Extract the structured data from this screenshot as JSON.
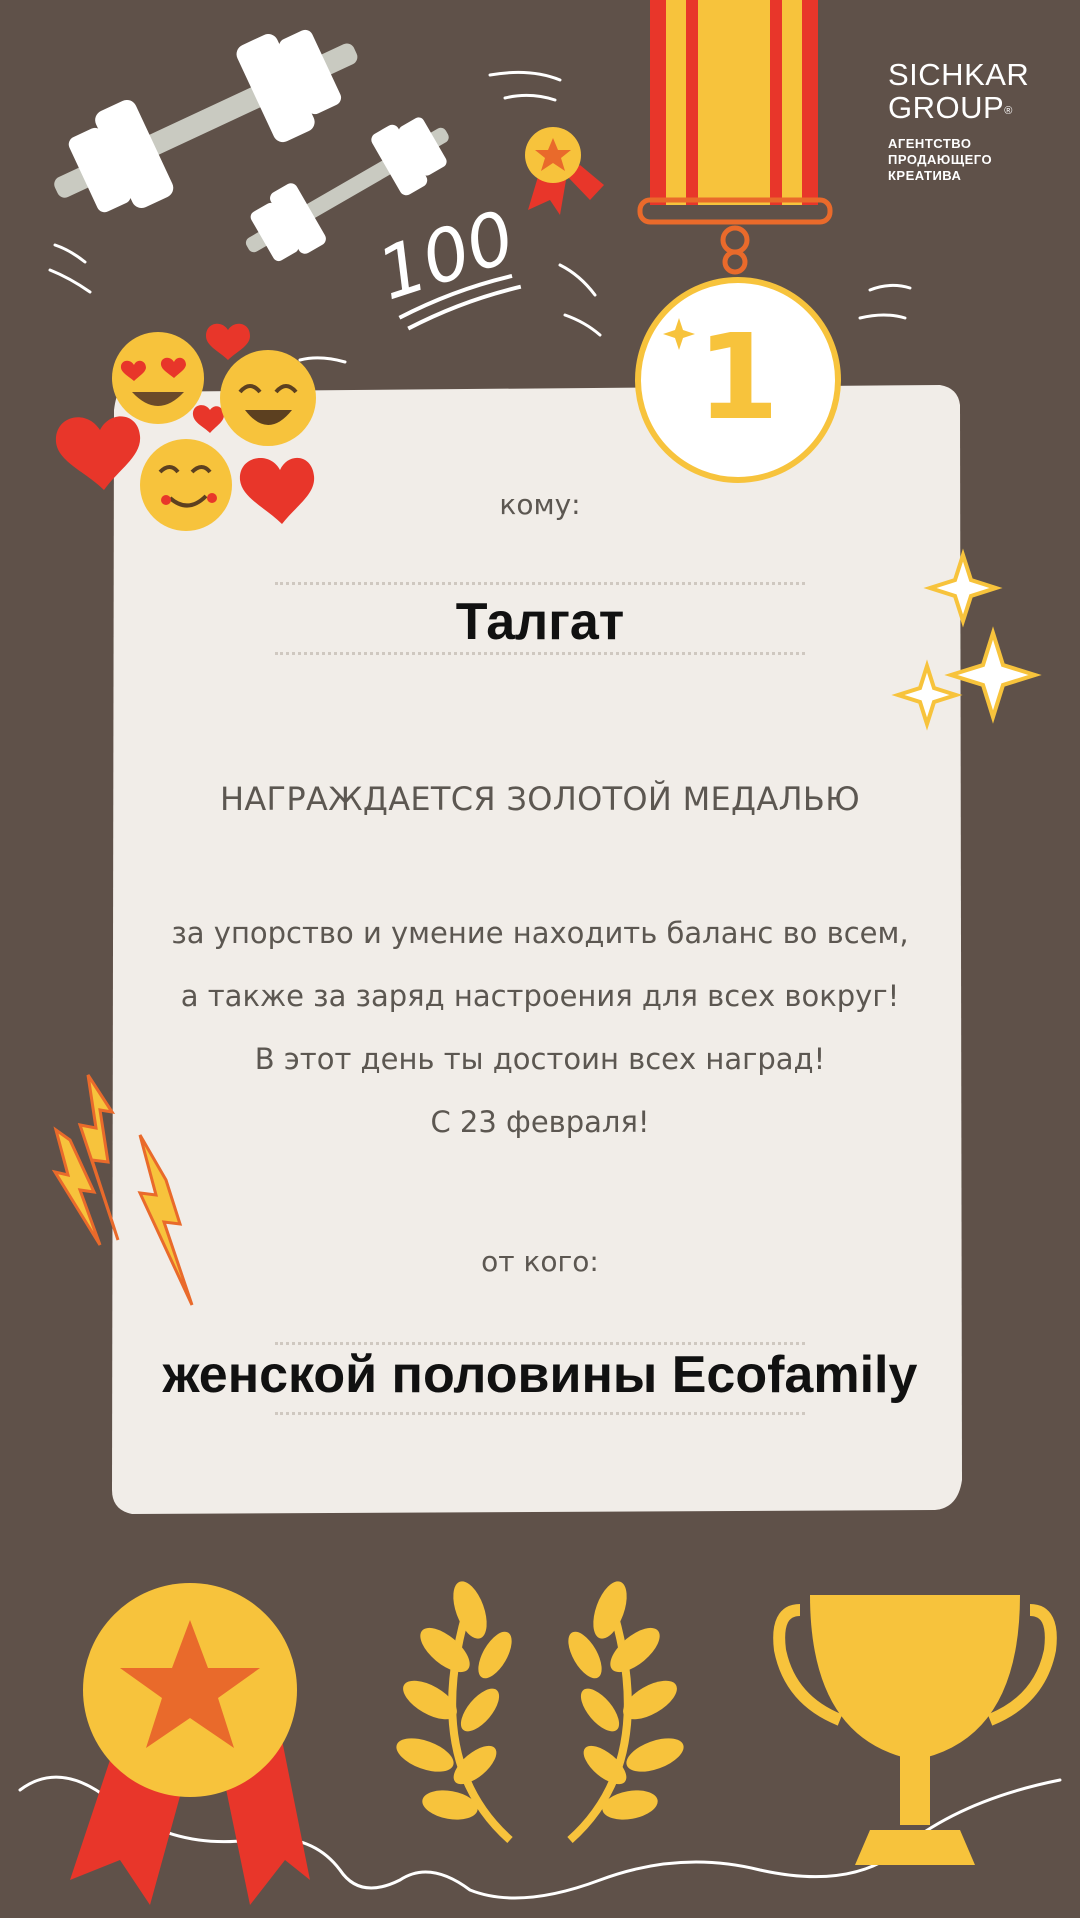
{
  "logo": {
    "line1": "SICHKAR",
    "line2": "GROUP",
    "reg": "®",
    "subtitle": [
      "АГЕНТСТВО",
      "ПРОДАЮЩЕГО",
      "КРЕАТИВА"
    ]
  },
  "certificate": {
    "to_label": "кому:",
    "recipient": "Талгат",
    "heading": "НАГРАЖДАЕТСЯ ЗОЛОТОЙ МЕДАЛЬЮ",
    "body_lines": [
      "за упорство и умение находить баланс во всем,",
      "а также за заряд настроения для всех вокруг!",
      "В этот день ты достоин всех наград!",
      "С 23 февраля!"
    ],
    "from_label": "от кого:",
    "sender": "женской половины Ecofamily"
  },
  "decorations": {
    "medal_number": "1",
    "badge_text": "100",
    "icons": [
      "dumbbell-icon",
      "medal-icon",
      "emoji-icon",
      "heart-icon",
      "sparkle-icon",
      "lightning-icon",
      "award-ribbon-icon",
      "laurel-wreath-icon",
      "trophy-icon"
    ]
  },
  "colors": {
    "background": "#5f5149",
    "paper": "#f1ede8",
    "gold": "#f7c33c",
    "red": "#e8362a",
    "text": "#5c5751"
  }
}
